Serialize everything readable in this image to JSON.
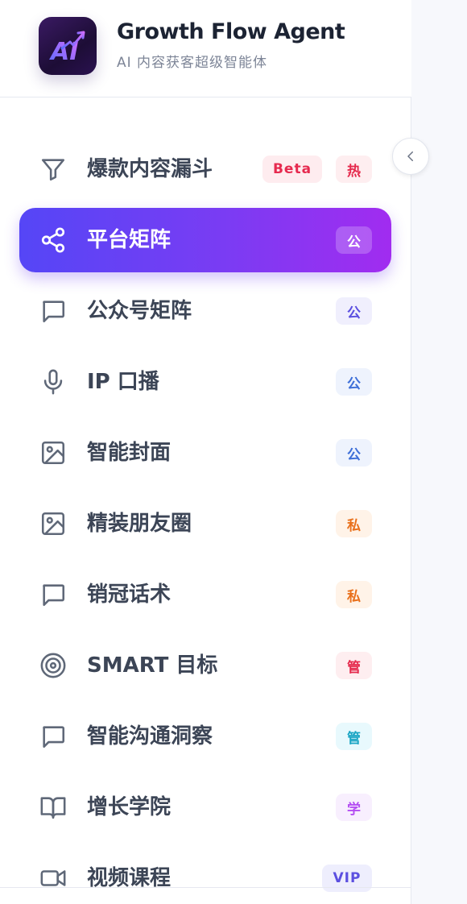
{
  "app": {
    "title": "Growth Flow Agent",
    "subtitle": "AI 内容获客超级智能体",
    "logo_text": "AI"
  },
  "nav": {
    "items": [
      {
        "label": "爆款内容漏斗",
        "icon": "filter-icon",
        "badges": [
          "Beta",
          "热"
        ]
      },
      {
        "label": "平台矩阵",
        "icon": "share-icon",
        "badges": [
          "公"
        ],
        "active": true
      },
      {
        "label": "公众号矩阵",
        "icon": "message-square-icon",
        "badges": [
          "公"
        ]
      },
      {
        "label": "IP 口播",
        "icon": "microphone-icon",
        "badges": [
          "公"
        ]
      },
      {
        "label": "智能封面",
        "icon": "image-icon",
        "badges": [
          "公"
        ]
      },
      {
        "label": "精装朋友圈",
        "icon": "image-icon",
        "badges": [
          "私"
        ]
      },
      {
        "label": "销冠话术",
        "icon": "message-square-icon",
        "badges": [
          "私"
        ]
      },
      {
        "label": "SMART 目标",
        "icon": "target-icon",
        "badges": [
          "管"
        ]
      },
      {
        "label": "智能沟通洞察",
        "icon": "message-square-icon",
        "badges": [
          "管"
        ]
      },
      {
        "label": "增长学院",
        "icon": "book-open-icon",
        "badges": [
          "学"
        ]
      },
      {
        "label": "视频课程",
        "icon": "video-icon",
        "badges": [
          "VIP"
        ]
      }
    ]
  },
  "colors": {
    "accent_start": "#5546f6",
    "accent_end": "#a12cf0",
    "text_primary": "#1c2333",
    "text_nav": "#3c4556",
    "hot_red": "#e52a4d",
    "public_blue": "#3e6fd8",
    "private_orange": "#e9711d",
    "manage_cyan": "#1aa5c4",
    "learn_purple": "#b44ef2"
  }
}
